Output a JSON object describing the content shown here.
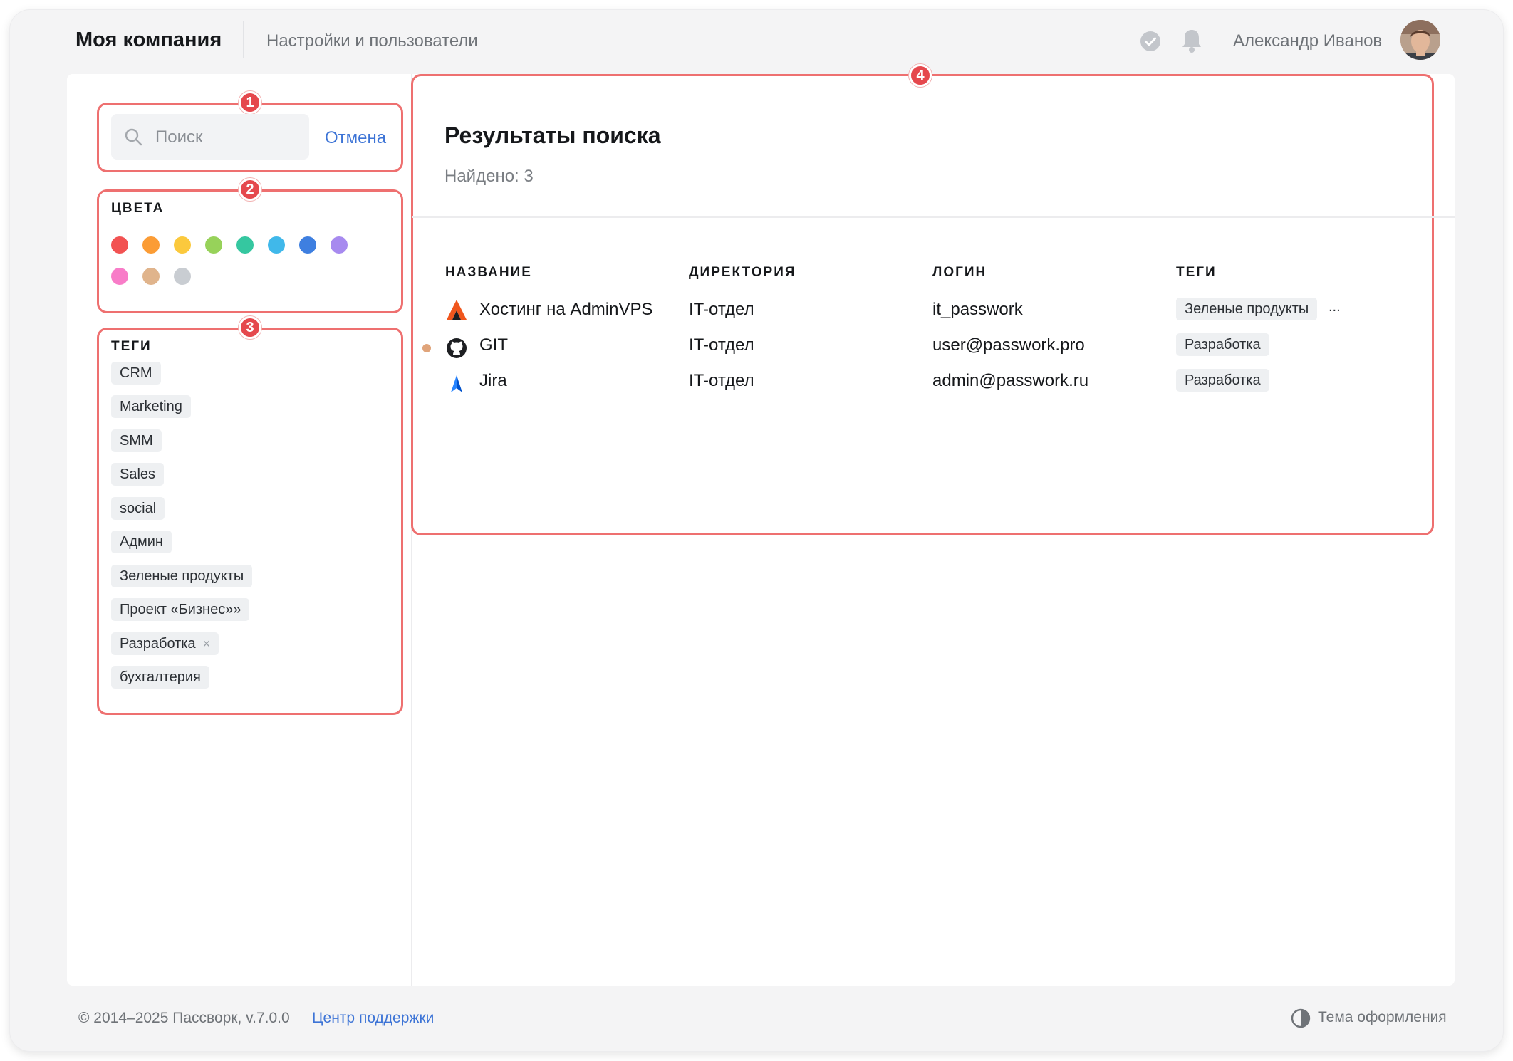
{
  "header": {
    "brand": "Моя компания",
    "subtitle": "Настройки и пользователи",
    "user_name": "Александр Иванов"
  },
  "annotations": [
    "1",
    "2",
    "3",
    "4"
  ],
  "search": {
    "placeholder": "Поиск",
    "cancel_label": "Отмена"
  },
  "colors": {
    "title": "ЦВЕТА",
    "swatches": [
      "#f25252",
      "#fb9c35",
      "#fbc93d",
      "#97d25a",
      "#35c7a0",
      "#40b8ea",
      "#3e7fe0",
      "#a78aef",
      "#f87cc8",
      "#e0b48c",
      "#c9cdd2"
    ]
  },
  "tags": {
    "title": "ТЕГИ",
    "items": [
      "CRM",
      "Marketing",
      "SMM",
      "Sales",
      "social",
      "Админ",
      "Зеленые продукты",
      "Проект «Бизнес»»",
      "Разработка",
      "бухгалтерия"
    ],
    "active_remove_glyph": "×"
  },
  "results": {
    "title": "Результаты поиска",
    "count": "Найдено: 3",
    "columns": [
      "НАЗВАНИЕ",
      "ДИРЕКТОРИЯ",
      "ЛОГИН",
      "ТЕГИ"
    ],
    "rows": [
      {
        "icon": "adminvps-icon",
        "name": "Хостинг на AdminVPS",
        "directory": "IT-отдел",
        "login": "it_passwork",
        "tag": "Зеленые продукты",
        "more": "..."
      },
      {
        "icon": "github-icon",
        "name": "GIT",
        "directory": "IT-отдел",
        "login": "user@passwork.pro",
        "tag": "Разработка",
        "more": ""
      },
      {
        "icon": "jira-icon",
        "name": "Jira",
        "directory": "IT-отдел",
        "login": "admin@passwork.ru",
        "tag": "Разработка",
        "more": ""
      }
    ]
  },
  "footer": {
    "copyright": "© 2014–2025 Пассворк, v.7.0.0",
    "support_link": "Центр поддержки",
    "theme_label": "Тема оформления"
  }
}
